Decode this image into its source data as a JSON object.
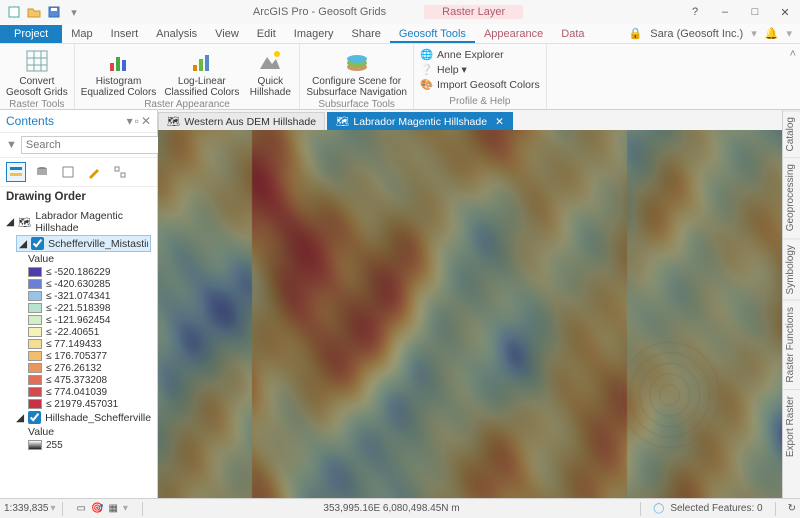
{
  "title": {
    "app": "ArcGIS Pro - Geosoft Grids",
    "context": "Raster Layer"
  },
  "win": {
    "help": "?",
    "min": "–",
    "max": "□",
    "close": "✕"
  },
  "tabs": {
    "file": "Project",
    "items": [
      "Map",
      "Insert",
      "Analysis",
      "View",
      "Edit",
      "Imagery",
      "Share",
      "Geosoft Tools"
    ],
    "context_items": [
      "Appearance",
      "Data"
    ],
    "active": "Geosoft Tools"
  },
  "user": {
    "name": "Sara (Geosoft Inc.)",
    "bell": "🔔"
  },
  "ribbon": {
    "groups": [
      {
        "label": "Raster Tools",
        "buttons": [
          {
            "name": "convert-grids",
            "label": "Convert\nGeosoft Grids"
          }
        ]
      },
      {
        "label": "Raster Appearance",
        "buttons": [
          {
            "name": "histogram-eq",
            "label": "Histogram\nEqualized Colors"
          },
          {
            "name": "loglinear",
            "label": "Log-Linear\nClassified Colors"
          },
          {
            "name": "quick-hillshade",
            "label": "Quick\nHillshade"
          }
        ]
      },
      {
        "label": "Subsurface Tools",
        "buttons": [
          {
            "name": "configure-scene",
            "label": "Configure Scene for\nSubsurface Navigation"
          }
        ]
      },
      {
        "label": "Profile & Help",
        "stack": [
          {
            "name": "anne-explorer",
            "label": "Anne Explorer"
          },
          {
            "name": "help",
            "label": "Help ▾"
          },
          {
            "name": "import-colors",
            "label": "Import Geosoft Colors"
          }
        ]
      }
    ]
  },
  "contents": {
    "title": "Contents",
    "search_placeholder": "Search",
    "drawing_order": "Drawing Order",
    "layer_group": "Labrador Magentic Hillshade",
    "layer_a": "Schefferville_Mistastin_Batholi",
    "value_label": "Value",
    "legend_colors": [
      "#4a3fa8",
      "#6a80d7",
      "#97c4e6",
      "#b7e3d2",
      "#d4efc6",
      "#f4f2b6",
      "#f6dd91",
      "#f2bd6d",
      "#ea965f",
      "#df6d58",
      "#d44a4f",
      "#c53248"
    ],
    "legend_labels": [
      "≤ -520.186229",
      "≤ -420.630285",
      "≤ -321.074341",
      "≤ -221.518398",
      "≤ -121.962454",
      "≤ -22.40651",
      "≤ 77.149433",
      "≤ 176.705377",
      "≤ 276.26132",
      "≤ 475.373208",
      "≤ 774.041039",
      "≤ 21979.457031"
    ],
    "layer_b": "Hillshade_Schefferville_Mistast",
    "layer_b_value": "255"
  },
  "docs": {
    "tab_a": "Western Aus DEM Hillshade",
    "tab_b": "Labrador Magentic Hillshade"
  },
  "right_tabs": [
    "Catalog",
    "Geoprocessing",
    "Symbology",
    "Raster Functions",
    "Export Raster"
  ],
  "status": {
    "scale": "1:339,835",
    "coords": "353,995.16E 6,080,498.45N m",
    "selected": "Selected Features: 0"
  }
}
